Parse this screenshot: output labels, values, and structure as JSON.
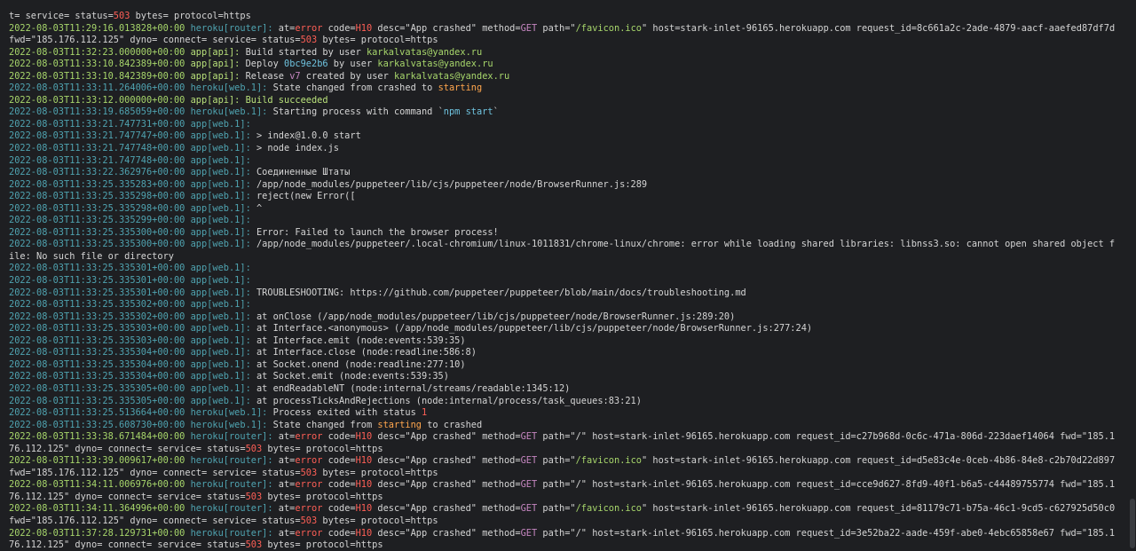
{
  "colors": {
    "text": "#d4d4d4",
    "timestamp": "#a7d66b",
    "timestamp_dim": "#4fa3b0",
    "source_heroku": "#4fa3b0",
    "source_app": "#4fa3b0",
    "key": "#c0c0c0",
    "error": "#ff5f56",
    "keyword_get": "#c586c0",
    "string": "#a7d66b",
    "highlight_yellow": "#e5c07b",
    "highlight_orange": "#ffa64d",
    "bold_green": "#b8e07a",
    "link": "#6fc3df"
  },
  "lines": [
    [
      [
        "t= service= status=",
        "text"
      ],
      [
        "503",
        "error"
      ],
      [
        " bytes= protocol=https",
        "text"
      ]
    ],
    [
      [
        "2022-08-03T11:29:16.013828+00:00",
        "timestamp"
      ],
      [
        " heroku[router]: ",
        "source_heroku"
      ],
      [
        "at=",
        "text"
      ],
      [
        "error",
        "error"
      ],
      [
        " code=",
        "text"
      ],
      [
        "H10",
        "error"
      ],
      [
        " desc=\"App crashed\" method=",
        "text"
      ],
      [
        "GET",
        "keyword_get"
      ],
      [
        " path=\"",
        "text"
      ],
      [
        "/favicon.ico",
        "string"
      ],
      [
        "\" host=stark-inlet-96165.herokuapp.com request_id=8c661a2c-2ade-4879-aacf-aaefed87df7d fwd=\"185.176.112.125\" dyno= connect= service= status=",
        "text"
      ],
      [
        "503",
        "error"
      ],
      [
        " bytes= protocol=https",
        "text"
      ]
    ],
    [
      [
        "2022-08-03T11:32:23.000000+00:00",
        "timestamp"
      ],
      [
        " app[api]: ",
        "bold_green"
      ],
      [
        "Build started by user ",
        "text"
      ],
      [
        "karkalvatas@yandex.ru",
        "string"
      ]
    ],
    [
      [
        "2022-08-03T11:33:10.842389+00:00",
        "timestamp"
      ],
      [
        " app[api]: ",
        "bold_green"
      ],
      [
        "Deploy ",
        "text"
      ],
      [
        "0bc9e2b6",
        "link"
      ],
      [
        " by user ",
        "text"
      ],
      [
        "karkalvatas@yandex.ru",
        "string"
      ]
    ],
    [
      [
        "2022-08-03T11:33:10.842389+00:00",
        "timestamp"
      ],
      [
        " app[api]: ",
        "bold_green"
      ],
      [
        "Release ",
        "text"
      ],
      [
        "v7",
        "keyword_get"
      ],
      [
        " created by user ",
        "text"
      ],
      [
        "karkalvatas@yandex.ru",
        "string"
      ]
    ],
    [
      [
        "2022-08-03T11:33:11.264006+00:00",
        "timestamp_dim"
      ],
      [
        " heroku[web.1]: ",
        "source_heroku"
      ],
      [
        "State changed from crashed to ",
        "text"
      ],
      [
        "starting",
        "highlight_orange"
      ]
    ],
    [
      [
        "2022-08-03T11:33:12.000000+00:00",
        "timestamp"
      ],
      [
        " app[api]: ",
        "bold_green"
      ],
      [
        "Build succeeded",
        "bold_green"
      ]
    ],
    [
      [
        "2022-08-03T11:33:19.685059+00:00",
        "timestamp_dim"
      ],
      [
        " heroku[web.1]: ",
        "source_heroku"
      ],
      [
        "Starting process with command `",
        "text"
      ],
      [
        "npm start",
        "link"
      ],
      [
        "`",
        "text"
      ]
    ],
    [
      [
        "2022-08-03T11:33:21.747731+00:00",
        "timestamp_dim"
      ],
      [
        " app[web.1]:",
        "source_app"
      ]
    ],
    [
      [
        "2022-08-03T11:33:21.747747+00:00",
        "timestamp_dim"
      ],
      [
        " app[web.1]: ",
        "source_app"
      ],
      [
        "> index@1.0.0 start",
        "text"
      ]
    ],
    [
      [
        "2022-08-03T11:33:21.747748+00:00",
        "timestamp_dim"
      ],
      [
        " app[web.1]: ",
        "source_app"
      ],
      [
        "> node index.js",
        "text"
      ]
    ],
    [
      [
        "2022-08-03T11:33:21.747748+00:00",
        "timestamp_dim"
      ],
      [
        " app[web.1]:",
        "source_app"
      ]
    ],
    [
      [
        "2022-08-03T11:33:22.362976+00:00",
        "timestamp_dim"
      ],
      [
        " app[web.1]: ",
        "source_app"
      ],
      [
        "Соединенные Штаты",
        "text"
      ]
    ],
    [
      [
        "2022-08-03T11:33:25.335283+00:00",
        "timestamp_dim"
      ],
      [
        " app[web.1]: ",
        "source_app"
      ],
      [
        "/app/node_modules/puppeteer/lib/cjs/puppeteer/node/BrowserRunner.js:289",
        "text"
      ]
    ],
    [
      [
        "2022-08-03T11:33:25.335298+00:00",
        "timestamp_dim"
      ],
      [
        " app[web.1]: ",
        "source_app"
      ],
      [
        "reject(new Error([",
        "text"
      ]
    ],
    [
      [
        "2022-08-03T11:33:25.335298+00:00",
        "timestamp_dim"
      ],
      [
        " app[web.1]: ",
        "source_app"
      ],
      [
        "^",
        "text"
      ]
    ],
    [
      [
        "2022-08-03T11:33:25.335299+00:00",
        "timestamp_dim"
      ],
      [
        " app[web.1]:",
        "source_app"
      ]
    ],
    [
      [
        "2022-08-03T11:33:25.335300+00:00",
        "timestamp_dim"
      ],
      [
        " app[web.1]: ",
        "source_app"
      ],
      [
        "Error: Failed to launch the browser process!",
        "text"
      ]
    ],
    [
      [
        "2022-08-03T11:33:25.335300+00:00",
        "timestamp_dim"
      ],
      [
        " app[web.1]: ",
        "source_app"
      ],
      [
        "/app/node_modules/puppeteer/.local-chromium/linux-1011831/chrome-linux/chrome: error while loading shared libraries: libnss3.so: cannot open shared object file: No such file or directory",
        "text"
      ]
    ],
    [
      [
        "2022-08-03T11:33:25.335301+00:00",
        "timestamp_dim"
      ],
      [
        " app[web.1]:",
        "source_app"
      ]
    ],
    [
      [
        "2022-08-03T11:33:25.335301+00:00",
        "timestamp_dim"
      ],
      [
        " app[web.1]:",
        "source_app"
      ]
    ],
    [
      [
        "2022-08-03T11:33:25.335301+00:00",
        "timestamp_dim"
      ],
      [
        " app[web.1]: ",
        "source_app"
      ],
      [
        "TROUBLESHOOTING: https://github.com/puppeteer/puppeteer/blob/main/docs/troubleshooting.md",
        "text"
      ]
    ],
    [
      [
        "2022-08-03T11:33:25.335302+00:00",
        "timestamp_dim"
      ],
      [
        " app[web.1]:",
        "source_app"
      ]
    ],
    [
      [
        "2022-08-03T11:33:25.335302+00:00",
        "timestamp_dim"
      ],
      [
        " app[web.1]: ",
        "source_app"
      ],
      [
        "at onClose (/app/node_modules/puppeteer/lib/cjs/puppeteer/node/BrowserRunner.js:289:20)",
        "text"
      ]
    ],
    [
      [
        "2022-08-03T11:33:25.335303+00:00",
        "timestamp_dim"
      ],
      [
        " app[web.1]: ",
        "source_app"
      ],
      [
        "at Interface.<anonymous> (/app/node_modules/puppeteer/lib/cjs/puppeteer/node/BrowserRunner.js:277:24)",
        "text"
      ]
    ],
    [
      [
        "2022-08-03T11:33:25.335303+00:00",
        "timestamp_dim"
      ],
      [
        " app[web.1]: ",
        "source_app"
      ],
      [
        "at Interface.emit (node:events:539:35)",
        "text"
      ]
    ],
    [
      [
        "2022-08-03T11:33:25.335304+00:00",
        "timestamp_dim"
      ],
      [
        " app[web.1]: ",
        "source_app"
      ],
      [
        "at Interface.close (node:readline:586:8)",
        "text"
      ]
    ],
    [
      [
        "2022-08-03T11:33:25.335304+00:00",
        "timestamp_dim"
      ],
      [
        " app[web.1]: ",
        "source_app"
      ],
      [
        "at Socket.onend (node:readline:277:10)",
        "text"
      ]
    ],
    [
      [
        "2022-08-03T11:33:25.335304+00:00",
        "timestamp_dim"
      ],
      [
        " app[web.1]: ",
        "source_app"
      ],
      [
        "at Socket.emit (node:events:539:35)",
        "text"
      ]
    ],
    [
      [
        "2022-08-03T11:33:25.335305+00:00",
        "timestamp_dim"
      ],
      [
        " app[web.1]: ",
        "source_app"
      ],
      [
        "at endReadableNT (node:internal/streams/readable:1345:12)",
        "text"
      ]
    ],
    [
      [
        "2022-08-03T11:33:25.335305+00:00",
        "timestamp_dim"
      ],
      [
        " app[web.1]: ",
        "source_app"
      ],
      [
        "at processTicksAndRejections (node:internal/process/task_queues:83:21)",
        "text"
      ]
    ],
    [
      [
        "2022-08-03T11:33:25.513664+00:00",
        "timestamp_dim"
      ],
      [
        " heroku[web.1]: ",
        "source_heroku"
      ],
      [
        "Process exited with status ",
        "text"
      ],
      [
        "1",
        "error"
      ]
    ],
    [
      [
        "2022-08-03T11:33:25.608730+00:00",
        "timestamp_dim"
      ],
      [
        " heroku[web.1]: ",
        "source_heroku"
      ],
      [
        "State changed from ",
        "text"
      ],
      [
        "starting",
        "highlight_orange"
      ],
      [
        " to crashed",
        "text"
      ]
    ],
    [
      [
        "2022-08-03T11:33:38.671484+00:00",
        "timestamp"
      ],
      [
        " heroku[router]: ",
        "source_heroku"
      ],
      [
        "at=",
        "text"
      ],
      [
        "error",
        "error"
      ],
      [
        " code=",
        "text"
      ],
      [
        "H10",
        "error"
      ],
      [
        " desc=\"App crashed\" method=",
        "text"
      ],
      [
        "GET",
        "keyword_get"
      ],
      [
        " path=\"/\" host=stark-inlet-96165.herokuapp.com request_id=c27b968d-0c6c-471a-806d-223daef14064 fwd=\"185.176.112.125\" dyno= connect= service= status=",
        "text"
      ],
      [
        "503",
        "error"
      ],
      [
        " bytes= protocol=https",
        "text"
      ]
    ],
    [
      [
        "2022-08-03T11:33:39.009617+00:00",
        "timestamp"
      ],
      [
        " heroku[router]: ",
        "source_heroku"
      ],
      [
        "at=",
        "text"
      ],
      [
        "error",
        "error"
      ],
      [
        " code=",
        "text"
      ],
      [
        "H10",
        "error"
      ],
      [
        " desc=\"App crashed\" method=",
        "text"
      ],
      [
        "GET",
        "keyword_get"
      ],
      [
        " path=\"",
        "text"
      ],
      [
        "/favicon.ico",
        "string"
      ],
      [
        "\" host=stark-inlet-96165.herokuapp.com request_id=d5e83c4e-0ceb-4b86-84e8-c2b70d22d897 fwd=\"185.176.112.125\" dyno= connect= service= status=",
        "text"
      ],
      [
        "503",
        "error"
      ],
      [
        " bytes= protocol=https",
        "text"
      ]
    ],
    [
      [
        "2022-08-03T11:34:11.006976+00:00",
        "timestamp"
      ],
      [
        " heroku[router]: ",
        "source_heroku"
      ],
      [
        "at=",
        "text"
      ],
      [
        "error",
        "error"
      ],
      [
        " code=",
        "text"
      ],
      [
        "H10",
        "error"
      ],
      [
        " desc=\"App crashed\" method=",
        "text"
      ],
      [
        "GET",
        "keyword_get"
      ],
      [
        " path=\"/\" host=stark-inlet-96165.herokuapp.com request_id=cce9d627-8fd9-40f1-b6a5-c44489755774 fwd=\"185.176.112.125\" dyno= connect= service= status=",
        "text"
      ],
      [
        "503",
        "error"
      ],
      [
        " bytes= protocol=https",
        "text"
      ]
    ],
    [
      [
        "2022-08-03T11:34:11.364996+00:00",
        "timestamp"
      ],
      [
        " heroku[router]: ",
        "source_heroku"
      ],
      [
        "at=",
        "text"
      ],
      [
        "error",
        "error"
      ],
      [
        " code=",
        "text"
      ],
      [
        "H10",
        "error"
      ],
      [
        " desc=\"App crashed\" method=",
        "text"
      ],
      [
        "GET",
        "keyword_get"
      ],
      [
        " path=\"",
        "text"
      ],
      [
        "/favicon.ico",
        "string"
      ],
      [
        "\" host=stark-inlet-96165.herokuapp.com request_id=81179c71-b75a-46c1-9cd5-c627925d50c0 fwd=\"185.176.112.125\" dyno= connect= service= status=",
        "text"
      ],
      [
        "503",
        "error"
      ],
      [
        " bytes= protocol=https",
        "text"
      ]
    ],
    [
      [
        "2022-08-03T11:37:28.129731+00:00",
        "timestamp"
      ],
      [
        " heroku[router]: ",
        "source_heroku"
      ],
      [
        "at=",
        "text"
      ],
      [
        "error",
        "error"
      ],
      [
        " code=",
        "text"
      ],
      [
        "H10",
        "error"
      ],
      [
        " desc=\"App crashed\" method=",
        "text"
      ],
      [
        "GET",
        "keyword_get"
      ],
      [
        " path=\"/\" host=stark-inlet-96165.herokuapp.com request_id=3e52ba22-aade-459f-abe0-4ebc65858e67 fwd=\"185.176.112.125\" dyno= connect= service= status=",
        "text"
      ],
      [
        "503",
        "error"
      ],
      [
        " bytes= protocol=https",
        "text"
      ]
    ]
  ]
}
